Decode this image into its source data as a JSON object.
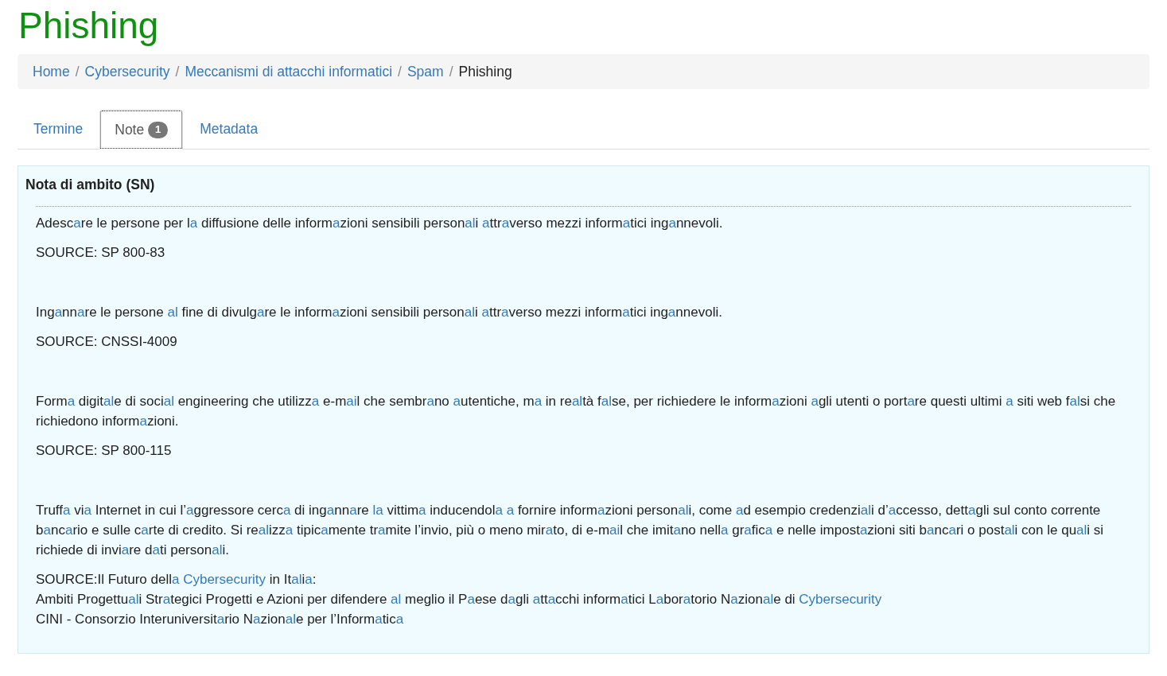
{
  "title": "Phishing",
  "breadcrumb": {
    "separator": "/",
    "items": [
      {
        "label": "Home",
        "current": false
      },
      {
        "label": "Cybersecurity",
        "current": false
      },
      {
        "label": "Meccanismi di attacchi informatici",
        "current": false
      },
      {
        "label": "Spam",
        "current": false
      },
      {
        "label": "Phishing",
        "current": true
      }
    ]
  },
  "tabs": [
    {
      "label": "Termine",
      "selected": false
    },
    {
      "label": "Note",
      "badge": "1",
      "selected": true
    },
    {
      "label": "Metadata",
      "selected": false
    }
  ],
  "panel": {
    "heading": "Nota di ambito (SN)",
    "entries": [
      {
        "definition": [
          {
            "text": "Adesc"
          },
          {
            "link": "a"
          },
          {
            "text": "re le persone per l"
          },
          {
            "link": "a"
          },
          {
            "text": " diffusione delle inform"
          },
          {
            "link": "a"
          },
          {
            "text": "zioni sensibili person"
          },
          {
            "link": "al"
          },
          {
            "text": "i "
          },
          {
            "link": "a"
          },
          {
            "text": "ttr"
          },
          {
            "link": "a"
          },
          {
            "text": "verso mezzi inform"
          },
          {
            "link": "a"
          },
          {
            "text": "tici ing"
          },
          {
            "link": "a"
          },
          {
            "text": "nnevoli."
          }
        ],
        "source": [
          [
            {
              "text": "SOURCE: SP 800-83"
            }
          ]
        ]
      },
      {
        "definition": [
          {
            "text": "Ing"
          },
          {
            "link": "a"
          },
          {
            "text": "nn"
          },
          {
            "link": "a"
          },
          {
            "text": "re le persone "
          },
          {
            "link": "al"
          },
          {
            "text": " fine di divulg"
          },
          {
            "link": "a"
          },
          {
            "text": "re le inform"
          },
          {
            "link": "a"
          },
          {
            "text": "zioni sensibili person"
          },
          {
            "link": "al"
          },
          {
            "text": "i "
          },
          {
            "link": "a"
          },
          {
            "text": "ttr"
          },
          {
            "link": "a"
          },
          {
            "text": "verso mezzi inform"
          },
          {
            "link": "a"
          },
          {
            "text": "tici ing"
          },
          {
            "link": "a"
          },
          {
            "text": "nnevoli."
          }
        ],
        "source": [
          [
            {
              "text": "SOURCE: CNSSI-4009"
            }
          ]
        ]
      },
      {
        "definition": [
          {
            "text": "Form"
          },
          {
            "link": "a"
          },
          {
            "text": " digit"
          },
          {
            "link": "al"
          },
          {
            "text": "e di soci"
          },
          {
            "link": "al"
          },
          {
            "text": " engineering che utilizz"
          },
          {
            "link": "a"
          },
          {
            "text": " e-m"
          },
          {
            "link": "ai"
          },
          {
            "text": "l che sembr"
          },
          {
            "link": "a"
          },
          {
            "text": "no "
          },
          {
            "link": "a"
          },
          {
            "text": "utentiche, m"
          },
          {
            "link": "a"
          },
          {
            "text": " in re"
          },
          {
            "link": "al"
          },
          {
            "text": "tà f"
          },
          {
            "link": "al"
          },
          {
            "text": "se, per richiedere le inform"
          },
          {
            "link": "a"
          },
          {
            "text": "zioni "
          },
          {
            "link": "a"
          },
          {
            "text": "gli utenti o port"
          },
          {
            "link": "a"
          },
          {
            "text": "re questi ultimi "
          },
          {
            "link": "a"
          },
          {
            "text": " siti web f"
          },
          {
            "link": "al"
          },
          {
            "text": "si che richiedono inform"
          },
          {
            "link": "a"
          },
          {
            "text": "zioni."
          }
        ],
        "source": [
          [
            {
              "text": "SOURCE: SP 800-115"
            }
          ]
        ]
      },
      {
        "definition": [
          {
            "text": "Truff"
          },
          {
            "link": "a"
          },
          {
            "text": " vi"
          },
          {
            "link": "a"
          },
          {
            "text": " Internet in cui l’"
          },
          {
            "link": "a"
          },
          {
            "text": "ggressore cerc"
          },
          {
            "link": "a"
          },
          {
            "text": " di ing"
          },
          {
            "link": "a"
          },
          {
            "text": "nn"
          },
          {
            "link": "a"
          },
          {
            "text": "re "
          },
          {
            "link": "la"
          },
          {
            "text": " vittim"
          },
          {
            "link": "a"
          },
          {
            "text": " inducendol"
          },
          {
            "link": "a a"
          },
          {
            "text": " fornire inform"
          },
          {
            "link": "a"
          },
          {
            "text": "zioni person"
          },
          {
            "link": "al"
          },
          {
            "text": "i, come "
          },
          {
            "link": "a"
          },
          {
            "text": "d esempio credenzi"
          },
          {
            "link": "al"
          },
          {
            "text": "i d’"
          },
          {
            "link": "a"
          },
          {
            "text": "ccesso, dett"
          },
          {
            "link": "a"
          },
          {
            "text": "gli sul conto corrente b"
          },
          {
            "link": "a"
          },
          {
            "text": "nc"
          },
          {
            "link": "a"
          },
          {
            "text": "rio e sulle c"
          },
          {
            "link": "a"
          },
          {
            "text": "rte di credito. Si re"
          },
          {
            "link": "al"
          },
          {
            "text": "izz"
          },
          {
            "link": "a"
          },
          {
            "text": " tipic"
          },
          {
            "link": "a"
          },
          {
            "text": "mente tr"
          },
          {
            "link": "a"
          },
          {
            "text": "mite l’invio, più o meno mir"
          },
          {
            "link": "a"
          },
          {
            "text": "to, di e-m"
          },
          {
            "link": "ai"
          },
          {
            "text": "l che imit"
          },
          {
            "link": "a"
          },
          {
            "text": "no nell"
          },
          {
            "link": "a"
          },
          {
            "text": " gr"
          },
          {
            "link": "a"
          },
          {
            "text": "fic"
          },
          {
            "link": "a"
          },
          {
            "text": " e nelle impost"
          },
          {
            "link": "a"
          },
          {
            "text": "zioni siti b"
          },
          {
            "link": "a"
          },
          {
            "text": "nc"
          },
          {
            "link": "a"
          },
          {
            "text": "ri o post"
          },
          {
            "link": "al"
          },
          {
            "text": "i con le qu"
          },
          {
            "link": "al"
          },
          {
            "text": "i si richiede di invi"
          },
          {
            "link": "a"
          },
          {
            "text": "re d"
          },
          {
            "link": "a"
          },
          {
            "text": "ti person"
          },
          {
            "link": "al"
          },
          {
            "text": "i."
          }
        ],
        "source": [
          [
            {
              "text": "SOURCE:Il Futuro dell"
            },
            {
              "link": "a Cybersecurity"
            },
            {
              "text": " in It"
            },
            {
              "link": "al"
            },
            {
              "text": "i"
            },
            {
              "link": "a"
            },
            {
              "text": ":"
            }
          ],
          [
            {
              "text": "Ambiti Progettu"
            },
            {
              "link": "al"
            },
            {
              "text": "i Str"
            },
            {
              "link": "a"
            },
            {
              "text": "tegici Progetti e Azioni per difendere "
            },
            {
              "link": "al"
            },
            {
              "text": " meglio il P"
            },
            {
              "link": "a"
            },
            {
              "text": "ese d"
            },
            {
              "link": "a"
            },
            {
              "text": "gli "
            },
            {
              "link": "a"
            },
            {
              "text": "tt"
            },
            {
              "link": "a"
            },
            {
              "text": "cchi inform"
            },
            {
              "link": "a"
            },
            {
              "text": "tici L"
            },
            {
              "link": "a"
            },
            {
              "text": "bor"
            },
            {
              "link": "a"
            },
            {
              "text": "torio N"
            },
            {
              "link": "a"
            },
            {
              "text": "zion"
            },
            {
              "link": "al"
            },
            {
              "text": "e di "
            },
            {
              "link": "Cybersecurity"
            }
          ],
          [
            {
              "text": "CINI - Consorzio Interuniversit"
            },
            {
              "link": "a"
            },
            {
              "text": "rio N"
            },
            {
              "link": "a"
            },
            {
              "text": "zion"
            },
            {
              "link": "al"
            },
            {
              "text": "e per l’Inform"
            },
            {
              "link": "a"
            },
            {
              "text": "tic"
            },
            {
              "link": "a"
            }
          ]
        ]
      }
    ]
  }
}
